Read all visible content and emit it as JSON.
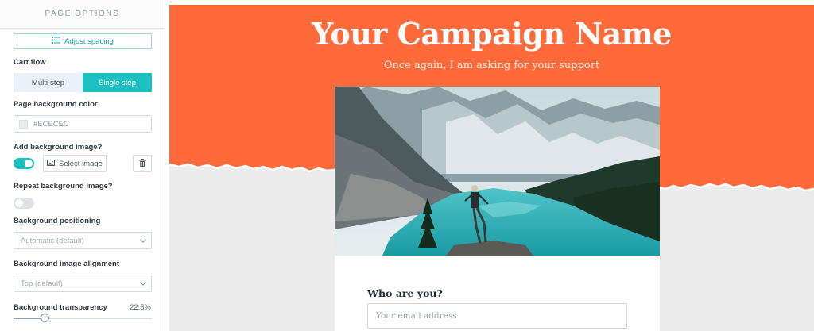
{
  "sidebar": {
    "header": "PAGE OPTIONS",
    "adjust_spacing_label": "Adjust spacing",
    "cart_flow": {
      "label": "Cart flow",
      "options": [
        "Multi-step",
        "Single step"
      ],
      "selected": "Single step"
    },
    "page_background_color": {
      "label": "Page background color",
      "value": "#ECECEC"
    },
    "add_background_image": {
      "label": "Add background image?",
      "enabled": true,
      "select_image_label": "Select image"
    },
    "repeat_background_image": {
      "label": "Repeat background image?",
      "enabled": false
    },
    "background_positioning": {
      "label": "Background positioning",
      "value": "Automatic (default)"
    },
    "background_image_alignment": {
      "label": "Background image alignment",
      "value": "Top (default)"
    },
    "background_transparency": {
      "label": "Background transparency",
      "value_text": "22.5%",
      "fraction": 0.225
    }
  },
  "preview": {
    "title": "Your Campaign Name",
    "subtitle": "Once again, I am asking for your support",
    "form_heading": "Who are you?",
    "email_placeholder": "Your email address"
  },
  "colors": {
    "accent": "#1ebfc0",
    "hero_orange": "#ff6a3b",
    "page_background": "#ececec"
  },
  "icons": [
    "list-icon",
    "image-icon",
    "trash-icon",
    "chevron-down-icon"
  ]
}
